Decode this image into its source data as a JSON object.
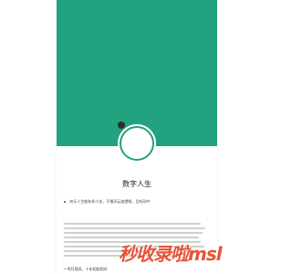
{
  "hero": {
    "background": "#23a27f"
  },
  "profile": {
    "title": "数字人生",
    "tagline": "欢乐人生能有多少关，不惧浮云遮望眼，且听风吟",
    "bottom_item": "• 明月随风，十年相陪相伴"
  },
  "watermark": {
    "text": "秒收录啦msl",
    "color": "#e64b2f"
  }
}
